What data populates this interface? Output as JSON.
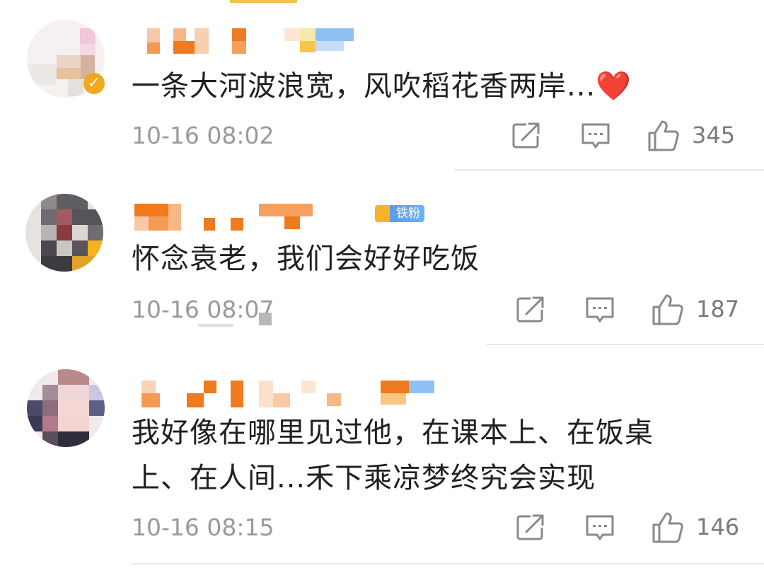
{
  "comments": [
    {
      "text": "一条大河波浪宽，风吹稻花香两岸...❤️",
      "time": "10-16 08:02",
      "likes": "345",
      "verified": true
    },
    {
      "text": "怀念袁老，我们会好好吃饭",
      "time": "10-16 08:07",
      "likes": "187",
      "badge": "铁粉"
    },
    {
      "text": "我好像在哪里见过他，在课本上、在饭桌\n上、在人间...禾下乘凉梦终究会实现",
      "time": "10-16 08:15",
      "likes": "146"
    }
  ],
  "icons": {
    "share": "share-icon",
    "comment": "comment-icon",
    "like": "thumbs-up-icon",
    "verified": "verified-check-icon"
  },
  "colors": {
    "text": "#202020",
    "meta": "#9a9a9a",
    "icon": "#8a8a8a",
    "name_orange": "#f07a1e",
    "verified": "#f0a81c",
    "fan_badge": "#5c9ce8"
  }
}
